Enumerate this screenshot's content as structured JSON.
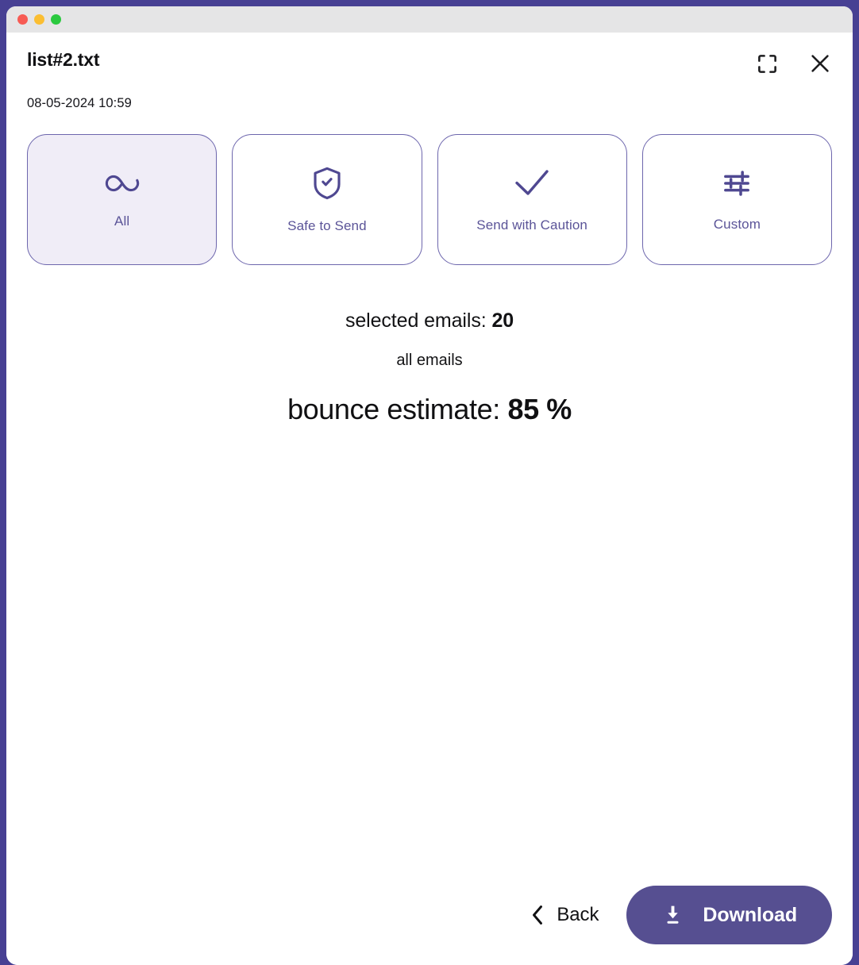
{
  "window": {
    "traffic_lights": [
      "close",
      "minimize",
      "maximize"
    ],
    "frame_color": "#474093",
    "titlebar_color": "#e5e5e6"
  },
  "header": {
    "file_title": "list#2.txt",
    "timestamp": "08-05-2024 10:59",
    "fullscreen_icon": "fullscreen-icon",
    "close_icon": "close-icon"
  },
  "filters": {
    "accent_color": "#4f4891",
    "selected_bg": "#f0edf7",
    "cards": [
      {
        "id": "all",
        "label": "All",
        "icon": "infinity-icon",
        "selected": true
      },
      {
        "id": "safe-to-send",
        "label": "Safe to Send",
        "icon": "shield-check-icon",
        "selected": false
      },
      {
        "id": "send-with-caution",
        "label": "Send with Caution",
        "icon": "check-icon",
        "selected": false
      },
      {
        "id": "custom",
        "label": "Custom",
        "icon": "sliders-icon",
        "selected": false
      }
    ]
  },
  "summary": {
    "selected_label": "selected emails:",
    "selected_count": "20",
    "scope": "all emails",
    "bounce_label": "bounce estimate:",
    "bounce_value": "85 %"
  },
  "footer": {
    "back_label": "Back",
    "back_icon": "chevron-left-icon",
    "download_label": "Download",
    "download_icon": "download-icon",
    "download_color": "#564f91"
  }
}
